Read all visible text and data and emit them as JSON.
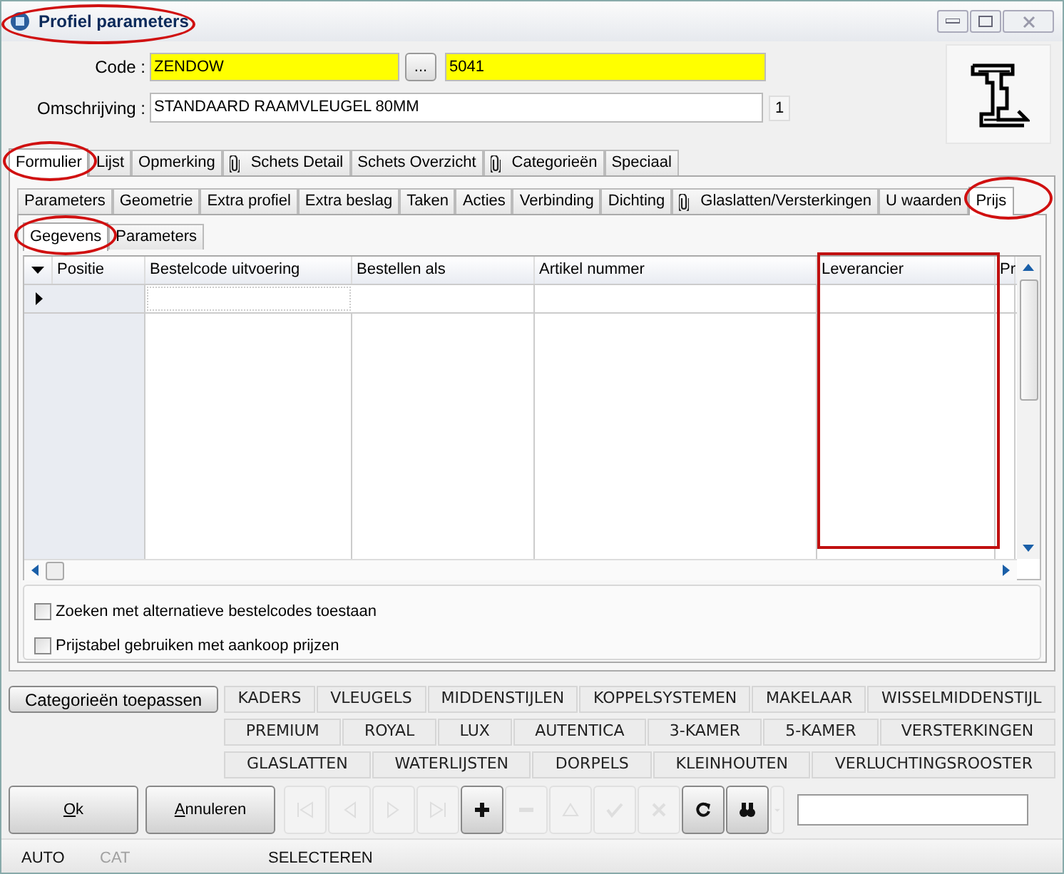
{
  "window": {
    "title": "Profiel parameters"
  },
  "code": {
    "label": "Code :",
    "value": "ZENDOW",
    "browse": "...",
    "number": "5041"
  },
  "description": {
    "label": "Omschrijving :",
    "value": "STANDAARD RAAMVLEUGEL 80MM",
    "count": "1"
  },
  "main_tabs": [
    {
      "label": "Formulier",
      "selected": true,
      "attachment": false
    },
    {
      "label": "Lijst",
      "selected": false,
      "attachment": false
    },
    {
      "label": "Opmerking",
      "selected": false,
      "attachment": false
    },
    {
      "label": "Schets Detail",
      "selected": false,
      "attachment": true
    },
    {
      "label": "Schets Overzicht",
      "selected": false,
      "attachment": false
    },
    {
      "label": "Categorieën",
      "selected": false,
      "attachment": true
    },
    {
      "label": "Speciaal",
      "selected": false,
      "attachment": false
    }
  ],
  "sub_tabs": [
    {
      "label": "Parameters",
      "selected": false,
      "attachment": false
    },
    {
      "label": "Geometrie",
      "selected": false,
      "attachment": false
    },
    {
      "label": "Extra profiel",
      "selected": false,
      "attachment": false
    },
    {
      "label": "Extra beslag",
      "selected": false,
      "attachment": false
    },
    {
      "label": "Taken",
      "selected": false,
      "attachment": false
    },
    {
      "label": "Acties",
      "selected": false,
      "attachment": false
    },
    {
      "label": "Verbinding",
      "selected": false,
      "attachment": false
    },
    {
      "label": "Dichting",
      "selected": false,
      "attachment": false
    },
    {
      "label": "Glaslatten/Versterkingen",
      "selected": false,
      "attachment": true
    },
    {
      "label": "U waarden",
      "selected": false,
      "attachment": false
    },
    {
      "label": "Prijs",
      "selected": true,
      "attachment": false
    }
  ],
  "inner_tabs": [
    {
      "label": "Gegevens",
      "selected": true
    },
    {
      "label": "Parameters",
      "selected": false
    }
  ],
  "table": {
    "columns": [
      "Positie",
      "Bestelcode uitvoering",
      "Bestellen als",
      "Artikel nummer",
      "Leverancier",
      "Pr"
    ]
  },
  "checkboxes": [
    {
      "label": "Zoeken met alternatieve bestelcodes toestaan",
      "checked": false
    },
    {
      "label": "Prijstabel gebruiken met aankoop prijzen",
      "checked": false
    }
  ],
  "apply_button": "Categorieën toepassen",
  "category_rows": [
    [
      "KADERS",
      "VLEUGELS",
      "MIDDENSTIJLEN",
      "KOPPELSYSTEMEN",
      "MAKELAAR",
      "WISSELMIDDENSTIJL"
    ],
    [
      "PREMIUM",
      "ROYAL",
      "LUX",
      "AUTENTICA",
      "3-KAMER",
      "5-KAMER",
      "VERSTERKINGEN"
    ],
    [
      "GLASLATTEN",
      "WATERLIJSTEN",
      "DORPELS",
      "KLEINHOUTEN",
      "VERLUCHTINGSROOSTER"
    ]
  ],
  "ok_button": {
    "label": "Ok"
  },
  "cancel_button": {
    "label": "Annuleren"
  },
  "navigator": [
    {
      "kind": "first",
      "disabled": true
    },
    {
      "kind": "prev",
      "disabled": true
    },
    {
      "kind": "next",
      "disabled": true
    },
    {
      "kind": "last",
      "disabled": true
    },
    {
      "kind": "add",
      "disabled": false
    },
    {
      "kind": "delete",
      "disabled": true
    },
    {
      "kind": "up",
      "disabled": true
    },
    {
      "kind": "post",
      "disabled": true
    },
    {
      "kind": "cancel",
      "disabled": true
    },
    {
      "kind": "refresh",
      "disabled": false
    },
    {
      "kind": "find",
      "disabled": false
    },
    {
      "kind": "dropdown",
      "disabled": true
    }
  ],
  "status_bar": [
    {
      "label": "AUTO",
      "disabled": false
    },
    {
      "label": "CAT",
      "disabled": true
    },
    {
      "label": "SELECTEREN",
      "disabled": false
    }
  ]
}
